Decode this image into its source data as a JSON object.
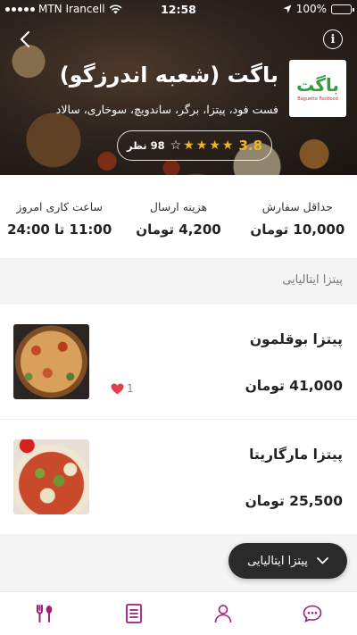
{
  "status_bar": {
    "carrier": "MTN Irancell",
    "time": "12:58",
    "battery": "100%"
  },
  "restaurant": {
    "name": "باگت (شعبه اندرزگو)",
    "tags": "فست فود، پیتزا، برگر، ساندویچ، سوخاری، سالاد",
    "rating": "3.8",
    "reviews": "98 نظر",
    "stars_filled": 4,
    "stars_total": 5,
    "logo_text": "باگت",
    "logo_subtext": "Baguette Fastfood"
  },
  "info": [
    {
      "label": "حداقل سفارش",
      "value": "10,000 تومان"
    },
    {
      "label": "هزینه ارسال",
      "value": "4,200 تومان"
    },
    {
      "label": "ساعت کاری امروز",
      "value": "11:00 تا 24:00"
    }
  ],
  "section": {
    "title": "پیتزا ایتالیایی"
  },
  "products": [
    {
      "name": "پیتزا بوقلمون",
      "price": "41,000 تومان",
      "likes": "1",
      "image": "turkey-pizza"
    },
    {
      "name": "پیتزا مارگاریتا",
      "price": "25,500 تومان",
      "image": "margherita-pizza"
    }
  ],
  "category_selector": {
    "label": "پیتزا ایتالیایی"
  },
  "bottom_nav": [
    "restaurant-icon",
    "menu-list-icon",
    "profile-icon",
    "chat-icon"
  ],
  "colors": {
    "accent": "#9c1f7d",
    "star": "#f3b61f",
    "like": "#e0424a",
    "logo_green": "#2f9e3b"
  }
}
